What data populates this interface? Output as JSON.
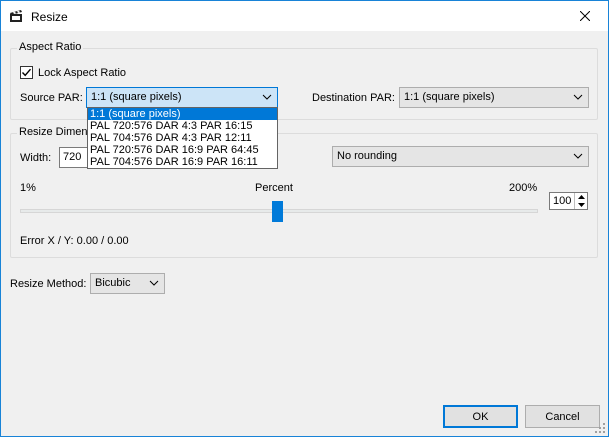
{
  "window": {
    "title": "Resize",
    "close_glyph": "✕"
  },
  "aspect_ratio": {
    "legend": "Aspect Ratio",
    "lock_label": "Lock Aspect Ratio",
    "lock_checked": true,
    "source_par_label": "Source PAR:",
    "source_par_value": "1:1 (square pixels)",
    "source_par_options": [
      "1:1 (square pixels)",
      "PAL 720:576 DAR 4:3 PAR 16:15",
      "PAL 704:576 DAR 4:3 PAR 12:11",
      "PAL 720:576 DAR 16:9 PAR 64:45",
      "PAL 704:576 DAR 16:9 PAR 16:11"
    ],
    "destination_par_label": "Destination PAR:",
    "destination_par_value": "1:1 (square pixels)"
  },
  "resize_dimensions": {
    "legend": "Resize Dimens",
    "width_label": "Width:",
    "width_value": "720",
    "rounding_value": "No rounding",
    "min_label": "1%",
    "mid_label": "Percent",
    "max_label": "200%",
    "percent": 100,
    "percent_value": "100",
    "error_label": "Error X / Y:  0.00 / 0.00"
  },
  "resize_method": {
    "label": "Resize Method:",
    "value": "Bicubic"
  },
  "buttons": {
    "ok": "OK",
    "cancel": "Cancel"
  },
  "colors": {
    "accent": "#0078d7",
    "border": "#1883d7"
  }
}
